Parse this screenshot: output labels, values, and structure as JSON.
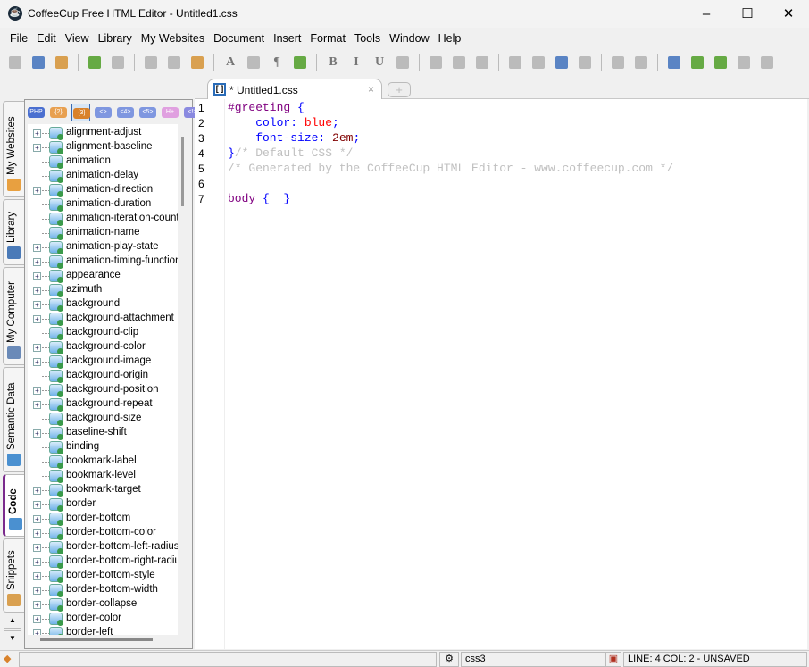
{
  "window": {
    "title": "CoffeeCup Free HTML Editor - Untitled1.css",
    "minimize": "–",
    "maximize": "☐",
    "close": "✕"
  },
  "menu": [
    "File",
    "Edit",
    "View",
    "Library",
    "My Websites",
    "Document",
    "Insert",
    "Format",
    "Tools",
    "Window",
    "Help"
  ],
  "toolbar": [
    "new",
    "save",
    "open",
    "undo",
    "redo",
    "cut",
    "copy",
    "paste",
    "font",
    "image",
    "paragraph",
    "download",
    "bold",
    "italic",
    "underline",
    "align",
    "list",
    "image-insert",
    "globe",
    "highlight",
    "color-wheel",
    "table",
    "form",
    "edit",
    "settings",
    "layout",
    "preview",
    "export",
    "more",
    "spellcheck"
  ],
  "toolbar_glyphs": {
    "bold": "B",
    "italic": "I",
    "underline": "U",
    "paragraph": "¶",
    "font": "A"
  },
  "tab": {
    "label": "* Untitled1.css",
    "close": "×",
    "new": "+"
  },
  "side_tabs": [
    "My Websites",
    "Library",
    "My Computer",
    "Semantic Data",
    "Code",
    "Snippets"
  ],
  "panel_tools": [
    {
      "label": "PHP",
      "color": "#4a6fd0"
    },
    {
      "label": "{2}",
      "color": "#e8a050"
    },
    {
      "label": "{3}",
      "color": "#d9822b"
    },
    {
      "label": "<>",
      "color": "#7f97e0"
    },
    {
      "label": "<4>",
      "color": "#7f97e0"
    },
    {
      "label": "<5>",
      "color": "#7f97e0"
    },
    {
      "label": "H+",
      "color": "#e0a0e0"
    },
    {
      "label": "<!>",
      "color": "#8a8ae0"
    }
  ],
  "tree": [
    {
      "label": "alignment-adjust",
      "exp": true
    },
    {
      "label": "alignment-baseline",
      "exp": true
    },
    {
      "label": "animation",
      "exp": false
    },
    {
      "label": "animation-delay",
      "exp": false
    },
    {
      "label": "animation-direction",
      "exp": true
    },
    {
      "label": "animation-duration",
      "exp": false
    },
    {
      "label": "animation-iteration-count",
      "exp": false
    },
    {
      "label": "animation-name",
      "exp": false
    },
    {
      "label": "animation-play-state",
      "exp": true
    },
    {
      "label": "animation-timing-function",
      "exp": true
    },
    {
      "label": "appearance",
      "exp": true
    },
    {
      "label": "azimuth",
      "exp": true
    },
    {
      "label": "background",
      "exp": true
    },
    {
      "label": "background-attachment",
      "exp": true
    },
    {
      "label": "background-clip",
      "exp": false
    },
    {
      "label": "background-color",
      "exp": true
    },
    {
      "label": "background-image",
      "exp": true
    },
    {
      "label": "background-origin",
      "exp": false
    },
    {
      "label": "background-position",
      "exp": true
    },
    {
      "label": "background-repeat",
      "exp": true
    },
    {
      "label": "background-size",
      "exp": false
    },
    {
      "label": "baseline-shift",
      "exp": true
    },
    {
      "label": "binding",
      "exp": false
    },
    {
      "label": "bookmark-label",
      "exp": false
    },
    {
      "label": "bookmark-level",
      "exp": false
    },
    {
      "label": "bookmark-target",
      "exp": true
    },
    {
      "label": "border",
      "exp": true
    },
    {
      "label": "border-bottom",
      "exp": true
    },
    {
      "label": "border-bottom-color",
      "exp": true
    },
    {
      "label": "border-bottom-left-radius",
      "exp": true
    },
    {
      "label": "border-bottom-right-radius",
      "exp": true
    },
    {
      "label": "border-bottom-style",
      "exp": true
    },
    {
      "label": "border-bottom-width",
      "exp": true
    },
    {
      "label": "border-collapse",
      "exp": true
    },
    {
      "label": "border-color",
      "exp": true
    },
    {
      "label": "border-left",
      "exp": true
    }
  ],
  "code": {
    "line_numbers": [
      "1",
      "2",
      "3",
      "4",
      "5",
      "6",
      "7"
    ],
    "lines": [
      [
        {
          "t": "#greeting",
          "c": "sel"
        },
        {
          "t": " {",
          "c": "br"
        }
      ],
      [
        {
          "t": "    color",
          "c": "prop"
        },
        {
          "t": ": ",
          "c": "prop"
        },
        {
          "t": "blue",
          "c": "val"
        },
        {
          "t": ";",
          "c": "prop"
        }
      ],
      [
        {
          "t": "    font-size",
          "c": "prop"
        },
        {
          "t": ": ",
          "c": "prop"
        },
        {
          "t": "2em",
          "c": "num"
        },
        {
          "t": ";",
          "c": "prop"
        }
      ],
      [
        {
          "t": "}",
          "c": "br"
        },
        {
          "t": "/* Default CSS */",
          "c": "cm"
        }
      ],
      [
        {
          "t": "/* Generated by the CoffeeCup HTML Editor - www.coffeecup.com */",
          "c": "cm"
        }
      ],
      [],
      [
        {
          "t": "body",
          "c": "sel"
        },
        {
          "t": " {  }",
          "c": "br"
        }
      ]
    ]
  },
  "status": {
    "doctype": "css3",
    "position": "LINE: 4  COL: 2 - UNSAVED"
  }
}
